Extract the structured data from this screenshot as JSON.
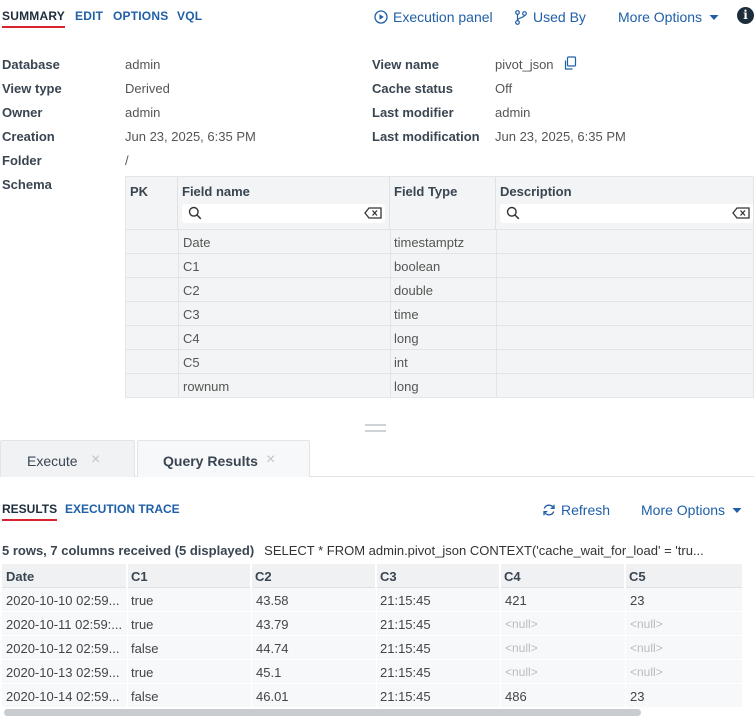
{
  "nav": {
    "tabs": [
      "SUMMARY",
      "EDIT",
      "OPTIONS",
      "VQL"
    ],
    "execution_panel": "Execution panel",
    "used_by": "Used By",
    "more_options": "More Options",
    "info": "i"
  },
  "meta": {
    "database_label": "Database",
    "database": "admin",
    "view_type_label": "View type",
    "view_type": "Derived",
    "owner_label": "Owner",
    "owner": "admin",
    "creation_label": "Creation",
    "creation": "Jun 23, 2025, 6:35 PM",
    "folder_label": "Folder",
    "folder": "/",
    "schema_label": "Schema",
    "view_name_label": "View name",
    "view_name": "pivot_json",
    "cache_status_label": "Cache status",
    "cache_status": "Off",
    "last_modifier_label": "Last modifier",
    "last_modifier": "admin",
    "last_modification_label": "Last modification",
    "last_modification": "Jun 23, 2025, 6:35 PM"
  },
  "schema": {
    "headers": {
      "pk": "PK",
      "field_name": "Field name",
      "field_type": "Field Type",
      "description": "Description"
    },
    "fields": [
      {
        "name": "Date",
        "type": "timestamptz"
      },
      {
        "name": "C1",
        "type": "boolean"
      },
      {
        "name": "C2",
        "type": "double"
      },
      {
        "name": "C3",
        "type": "time"
      },
      {
        "name": "C4",
        "type": "long"
      },
      {
        "name": "C5",
        "type": "int"
      },
      {
        "name": "rownum",
        "type": "long"
      }
    ]
  },
  "bottom": {
    "tabs": [
      {
        "label": "Execute"
      },
      {
        "label": "Query Results"
      }
    ],
    "close": "×",
    "result_tabs": [
      "RESULTS",
      "EXECUTION TRACE"
    ],
    "refresh": "Refresh",
    "more_options": "More Options",
    "row_count": "5 rows, 7 columns received (5 displayed)",
    "query": "SELECT * FROM admin.pivot_json CONTEXT('cache_wait_for_load' = 'tru..."
  },
  "results": {
    "columns": [
      "Date",
      "C1",
      "C2",
      "C3",
      "C4",
      "C5"
    ],
    "rows": [
      [
        "2020-10-10 02:59...",
        "true",
        "43.58",
        "21:15:45",
        "421",
        "23"
      ],
      [
        "2020-10-11 02:59:...",
        "true",
        "43.79",
        "21:15:45",
        "<null>",
        "<null>"
      ],
      [
        "2020-10-12 02:59...",
        "false",
        "44.74",
        "21:15:45",
        "<null>",
        "<null>"
      ],
      [
        "2020-10-13 02:59...",
        "true",
        "45.1",
        "21:15:45",
        "<null>",
        "<null>"
      ],
      [
        "2020-10-14 02:59...",
        "false",
        "46.01",
        "21:15:45",
        "486",
        "23"
      ]
    ]
  },
  "colors": {
    "accent_red": "#d9232e",
    "link_blue": "#1f5fa8",
    "dark": "#1e2d3b"
  }
}
